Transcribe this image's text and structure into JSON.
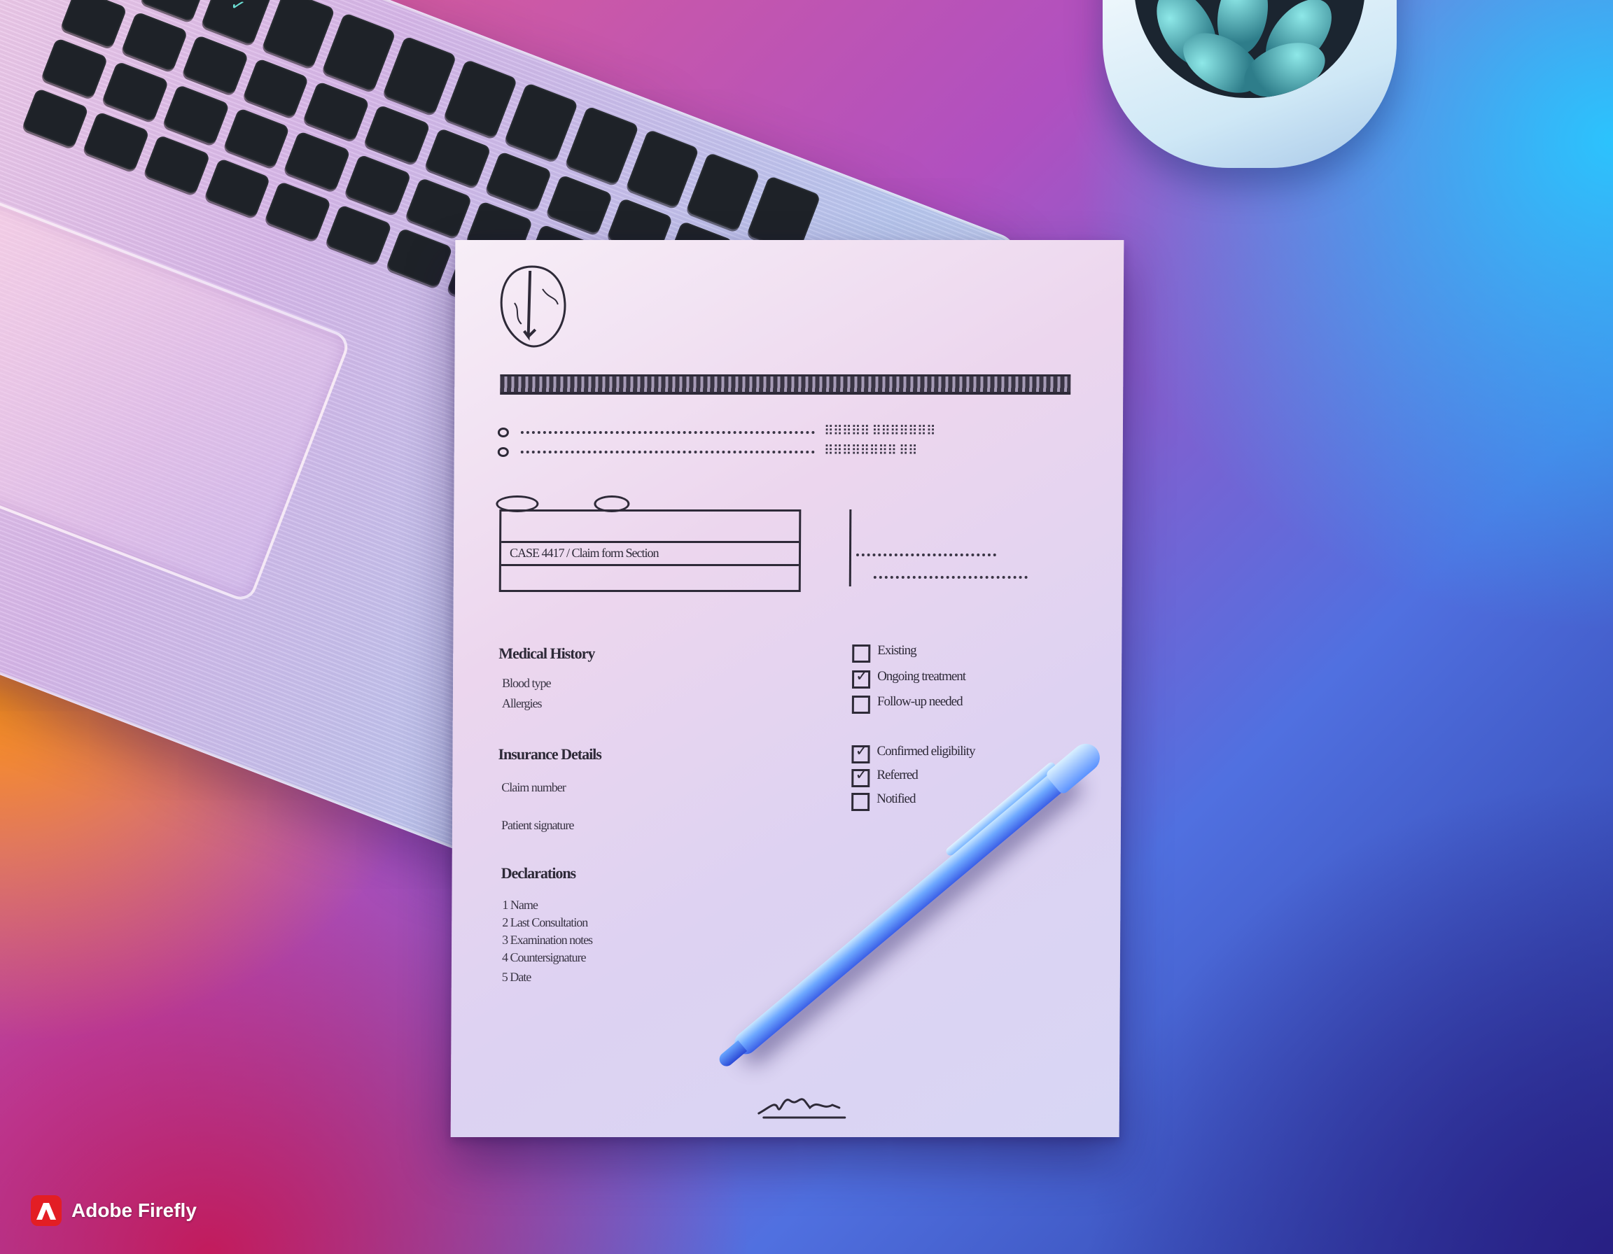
{
  "watermark": {
    "text": "Adobe Firefly",
    "logo_color": "#e31e24"
  },
  "laptop": {
    "keys": [
      "",
      "",
      "✓",
      "",
      "",
      "",
      "",
      "",
      "",
      "",
      "",
      "",
      "",
      "",
      "",
      "",
      "",
      "",
      "",
      "",
      "",
      "",
      "",
      "",
      "",
      "",
      "",
      "",
      "",
      "",
      "",
      "",
      "",
      "",
      "",
      "",
      "",
      "",
      "",
      "",
      "",
      "",
      "",
      "",
      "",
      "",
      "",
      ""
    ]
  },
  "paper": {
    "icon": "leaf-logo-icon",
    "box_text": "CASE 4417 / Claim form Section",
    "sections": [
      {
        "heading": "Medical History",
        "lines": [
          "Blood type",
          "Allergies"
        ]
      },
      {
        "heading": "Insurance Details",
        "lines": [
          "Claim number",
          "Patient signature"
        ]
      },
      {
        "heading": "Declarations"
      }
    ],
    "declaration_items": [
      "Name",
      "Last Consultation",
      "Examination notes",
      "Countersignature",
      "Date"
    ],
    "checkboxes": [
      {
        "label": "Existing",
        "checked": false
      },
      {
        "label": "Ongoing treatment",
        "checked": true
      },
      {
        "label": "Follow-up needed",
        "checked": false
      },
      {
        "label": "Confirmed eligibility",
        "checked": true
      },
      {
        "label": "Referred",
        "checked": true
      },
      {
        "label": "Notified",
        "checked": false
      }
    ]
  },
  "colors": {
    "ink": "#2e2a38",
    "pen": "#3a5ee6",
    "paper": "#ecd6ee"
  }
}
